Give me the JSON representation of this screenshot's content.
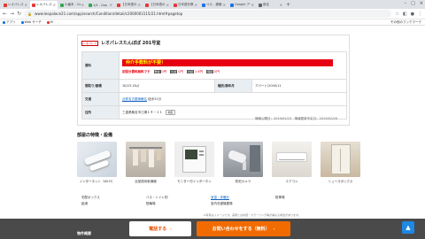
{
  "browser": {
    "tabs": [
      {
        "label": "レオパレス21",
        "color": "#e53935",
        "active": false
      },
      {
        "label": "レオパレス21",
        "color": "#e53935",
        "active": true
      },
      {
        "label": "小番本 - Goo",
        "color": "#34a853",
        "active": false
      },
      {
        "label": "1/4 - Goo",
        "color": "#34a853",
        "active": false
      },
      {
        "label": "【日本語のリスト】",
        "color": "#e53935",
        "active": false
      },
      {
        "label": "【日本語のリスト】",
        "color": "#e53935",
        "active": false
      },
      {
        "label": "日本語を教える",
        "color": "#e53935",
        "active": false
      },
      {
        "label": "ペス - 建築",
        "color": "#1a73e8",
        "active": false
      },
      {
        "label": "Google アート",
        "color": "#1a73e8",
        "active": false
      },
      {
        "label": "設定",
        "color": "#5f6368",
        "active": false
      }
    ],
    "new_tab": "+",
    "url": "www.leopalace21.com/app/search/Condition/detail/c2000003115/21.html#pagetop",
    "bookmarks": [
      "アプリ",
      "Web サーチ",
      "M"
    ],
    "bookmarks_right": "その他のブックマーク"
  },
  "property": {
    "brand": "レオパレス",
    "title": "レオパレスたんぽぽ 201号室",
    "rows": {
      "rent_label": "賃料",
      "banner": "仲介手数料が不要！",
      "rent_value": "初回分賃料無料です",
      "deposit_chip": "敷金",
      "deposit_val": "0円",
      "key_chip": "礼金",
      "key_val": "0円",
      "mgmt_chip": "共益",
      "mgmt_val": "1.6円",
      "other_chip": "保証",
      "other_val": "0円",
      "layout_label": "間取り/面積",
      "layout_value": "1K/23.18㎡",
      "type_label": "種別/築年月",
      "type_value": "アパート/2000/11",
      "access_label": "交通",
      "access_link": "近鉄名古屋線桑名",
      "access_rest": " 徒歩31分",
      "address_label": "住所",
      "address_value": "三重県桑名市江場１９－１１",
      "map_btn": "地図"
    },
    "dates": "情報公開日：2019/02/15　情報更新予定日：2019/02/26"
  },
  "features": {
    "title": "部屋の特徴・設備",
    "items": [
      {
        "caption": "インターネット（Wi-Fi）"
      },
      {
        "caption": "浴室換気乾燥機"
      },
      {
        "caption": "モニター付インターホン"
      },
      {
        "caption": "防犯カメラ"
      },
      {
        "caption": "エアコン"
      },
      {
        "caption": "シューズボックス"
      }
    ],
    "equipment": [
      [
        "宅配ボックス",
        "バス・トイレ別",
        "室温・床暖計",
        "駐車場"
      ],
      [
        "給湯",
        "駐輪場",
        "室内洗濯機置場",
        ""
      ]
    ],
    "note": "※写真はイメージです。実際とは内装・カラーリング等が異なる場合があります。"
  },
  "actions": {
    "section_label": "物件概要",
    "call": "電話する",
    "inquire": "お問い合わせをする（無料）",
    "top": "▲"
  },
  "colors": {
    "accent_red": "#e60012",
    "orange": "#f26b00",
    "bar": "#4a4a4a",
    "link": "#1565c0"
  }
}
